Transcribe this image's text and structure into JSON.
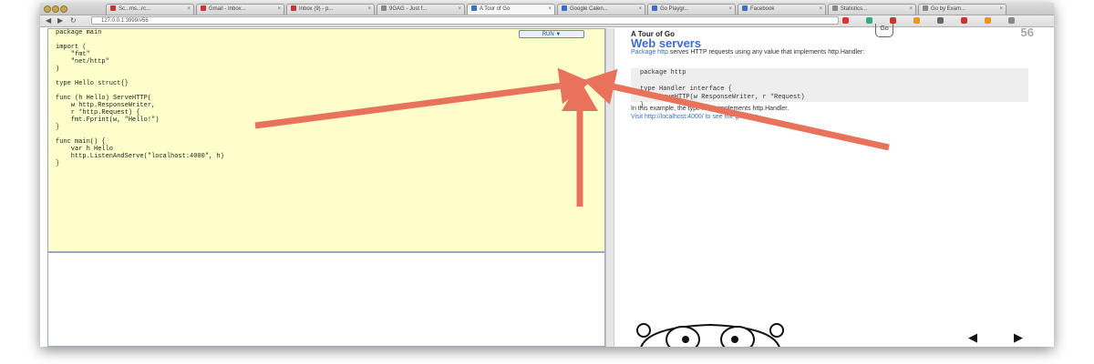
{
  "browser": {
    "tabs": [
      {
        "label": "Sc...ms...rc...",
        "favicon_color": "#c33"
      },
      {
        "label": "Gmail - Inbox...",
        "favicon_color": "#c33"
      },
      {
        "label": "Inbox (9) - p...",
        "favicon_color": "#c33"
      },
      {
        "label": "9GAG - Just f...",
        "favicon_color": "#888"
      },
      {
        "label": "A Tour of Go",
        "favicon_color": "#3a6ec8"
      },
      {
        "label": "Google Calen...",
        "favicon_color": "#3a6ec8"
      },
      {
        "label": "Go Playgr...",
        "favicon_color": "#3a6ec8"
      },
      {
        "label": "Facebook",
        "favicon_color": "#3a6ec8"
      },
      {
        "label": "Statistics...",
        "favicon_color": "#888"
      },
      {
        "label": "Go by Exam...",
        "favicon_color": "#888"
      }
    ],
    "address": "127.0.0.1:3999/#56",
    "back_glyph": "◀",
    "forward_glyph": "▶",
    "reload_glyph": "↻",
    "extension_icon_colors": [
      "#d33",
      "#3a8",
      "#c33",
      "#e90",
      "#666",
      "#c33",
      "#e90",
      "#888"
    ]
  },
  "editor": {
    "code": "package main\n\nimport (\n    \"fmt\"\n    \"net/http\"\n)\n\ntype Hello struct{}\n\nfunc (h Hello) ServeHTTP(\n    w http.ResponseWriter,\n    r *http.Request) {\n    fmt.Fprint(w, \"Hello!\")\n}\n\nfunc main() {\n    var h Hello\n    http.ListenAndServe(\"localhost:4000\", h)\n}",
    "run_label": "RUN ▼"
  },
  "slide": {
    "tour_name": "A Tour of Go",
    "title": "Web servers",
    "number": "56",
    "go_badge": "Go",
    "desc_link": "Package http",
    "desc_text": " serves HTTP requests using any value that implements http.Handler:",
    "code": "package http\n\ntype Handler interface {\n    ServeHTTP(w ResponseWriter, r *Request)\n}",
    "desc2": "In this example, the type Hello implements http.Handler.",
    "desc3": "Visit http://localhost:4000/ to see the greeting.",
    "prev_glyph": "◀",
    "next_glyph": "▶"
  },
  "annotations": {
    "arrow_color": "#e8735a",
    "arrow_count": 3
  }
}
